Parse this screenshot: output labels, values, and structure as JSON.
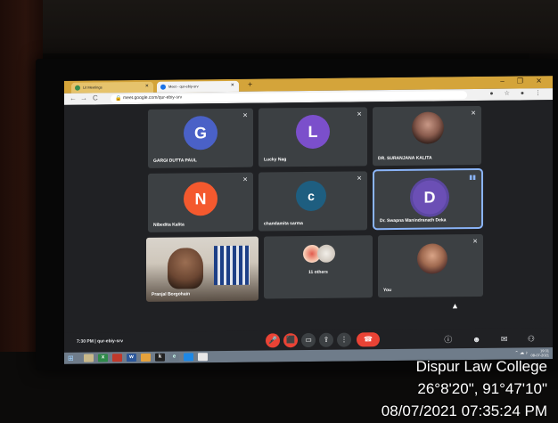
{
  "browser": {
    "tabs": [
      {
        "title": "Lit Meetings",
        "active": false
      },
      {
        "title": "Meet - qur-ebiy-srv",
        "active": true
      }
    ],
    "url": "meet.google.com/qur-ebiy-srv",
    "nav": {
      "back": "←",
      "forward": "→",
      "reload": "C"
    },
    "window_controls": "– ❐ ✕"
  },
  "meet": {
    "participants": [
      {
        "name": "GARGI DUTTA PAUL",
        "initial": "G",
        "color": "#4a61c7"
      },
      {
        "name": "Lucky Nag",
        "initial": "L",
        "color": "#7b4fcb"
      },
      {
        "name": "DR. SURANJANA KALITA",
        "photo": true
      },
      {
        "name": "Nibedita Kalita",
        "initial": "N",
        "color": "#f4592e"
      },
      {
        "name": "chandamita sarma",
        "initial": "c",
        "color": "#1e5e80"
      },
      {
        "name": "Dr. Swapna Manindranath Deka",
        "initial": "D",
        "color": "#6b4fb5",
        "speaking": true
      },
      {
        "name": "Pranjal Borgohain",
        "photo": true
      },
      {
        "name": "",
        "others_label": "11 others"
      },
      {
        "name": "You",
        "photo": true
      }
    ],
    "time_and_code": "7:30 PM  |  qur-ebiy-srv",
    "controls": [
      "mic-off",
      "camera-off",
      "captions",
      "present",
      "more",
      "end-call"
    ]
  },
  "taskbar": {
    "start": "⊞",
    "clock_time": "19:31",
    "clock_date": "08-07-2021",
    "lang": "ENG US"
  },
  "watermark": {
    "location": "Dispur Law College",
    "coords": "26°8'20\", 91°47'10\"",
    "datetime": "08/07/2021 07:35:24 PM"
  }
}
